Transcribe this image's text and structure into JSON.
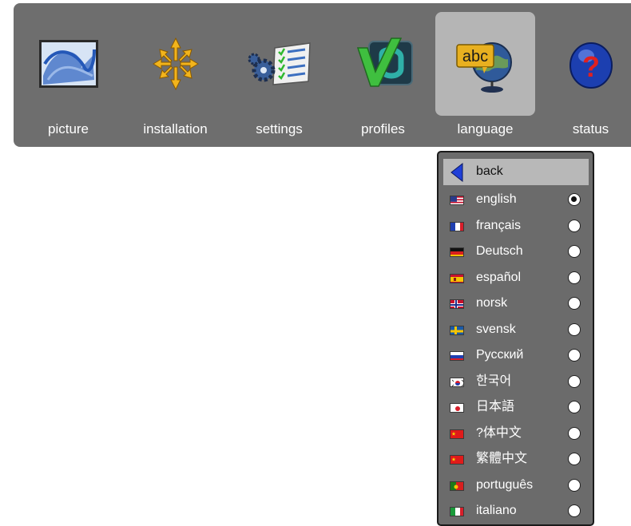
{
  "menu": {
    "items": [
      {
        "key": "picture",
        "label": "picture",
        "icon": "picture-icon"
      },
      {
        "key": "installation",
        "label": "installation",
        "icon": "installation-arrows-icon"
      },
      {
        "key": "settings",
        "label": "settings",
        "icon": "settings-gears-checklist-icon"
      },
      {
        "key": "profiles",
        "label": "profiles",
        "icon": "profiles-check-icon"
      },
      {
        "key": "language",
        "label": "language",
        "icon": "language-globe-abc-icon",
        "selected": true
      },
      {
        "key": "status",
        "label": "status",
        "icon": "status-question-icon"
      }
    ],
    "icon_badge_text": "abc"
  },
  "language_menu": {
    "back_label": "back",
    "languages": [
      {
        "label": "english",
        "flag": "us-flag-icon",
        "selected": true
      },
      {
        "label": "français",
        "flag": "fr-flag-icon",
        "selected": false
      },
      {
        "label": "Deutsch",
        "flag": "de-flag-icon",
        "selected": false
      },
      {
        "label": "español",
        "flag": "es-flag-icon",
        "selected": false
      },
      {
        "label": "norsk",
        "flag": "no-flag-icon",
        "selected": false
      },
      {
        "label": "svensk",
        "flag": "se-flag-icon",
        "selected": false
      },
      {
        "label": "Русский",
        "flag": "ru-flag-icon",
        "selected": false
      },
      {
        "label": "한국어",
        "flag": "kr-flag-icon",
        "selected": false
      },
      {
        "label": "日本語",
        "flag": "jp-flag-icon",
        "selected": false
      },
      {
        "label": "?体中文",
        "flag": "cn-flag-icon",
        "selected": false
      },
      {
        "label": "繁體中文",
        "flag": "cn-flag-icon",
        "selected": false
      },
      {
        "label": "português",
        "flag": "pt-flag-icon",
        "selected": false
      },
      {
        "label": "italiano",
        "flag": "it-flag-icon",
        "selected": false
      }
    ]
  },
  "colors": {
    "bar_bg": "#6e6e6e",
    "selected_tile": "#b5b5b5",
    "menu_bg": "#6b6b6b",
    "back_row_bg": "#b8b8b8",
    "accent_blue": "#1f3fd8"
  }
}
